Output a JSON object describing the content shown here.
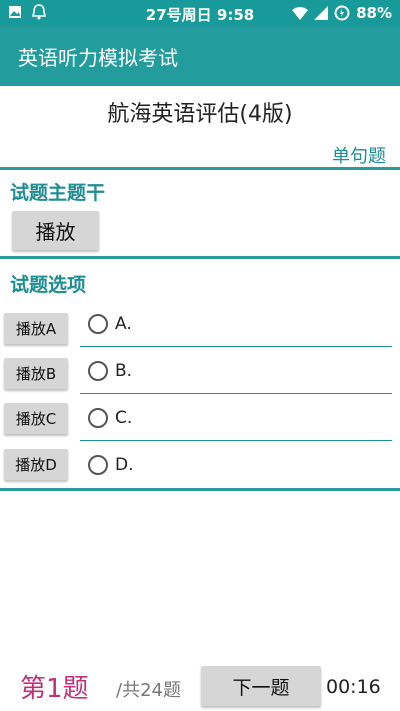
{
  "status_bar": {
    "datetime": "27号周日 9:58",
    "battery": "88%",
    "icons_left": [
      "image-icon",
      "notification-icon"
    ],
    "icons_right": [
      "wifi-icon",
      "signal-icon",
      "battery-saver-icon"
    ]
  },
  "app_bar": {
    "title": "英语听力模拟考试"
  },
  "exam": {
    "title": "航海英语评估(4版)",
    "question_type": "单句题"
  },
  "stem_section": {
    "label": "试题主题干",
    "play_label": "播放"
  },
  "options_section": {
    "label": "试题选项",
    "options": [
      {
        "play_label": "播放A",
        "text": "A."
      },
      {
        "play_label": "播放B",
        "text": "B."
      },
      {
        "play_label": "播放C",
        "text": "C."
      },
      {
        "play_label": "播放D",
        "text": "D."
      }
    ]
  },
  "footer": {
    "current": "第1题",
    "total": "/共24题",
    "next_label": "下一题",
    "timer": "00:16"
  },
  "colors": {
    "status_bar": "#199a9a",
    "app_bar": "#229c9c",
    "accent": "#1e8d94",
    "question_number": "#c0317a"
  }
}
